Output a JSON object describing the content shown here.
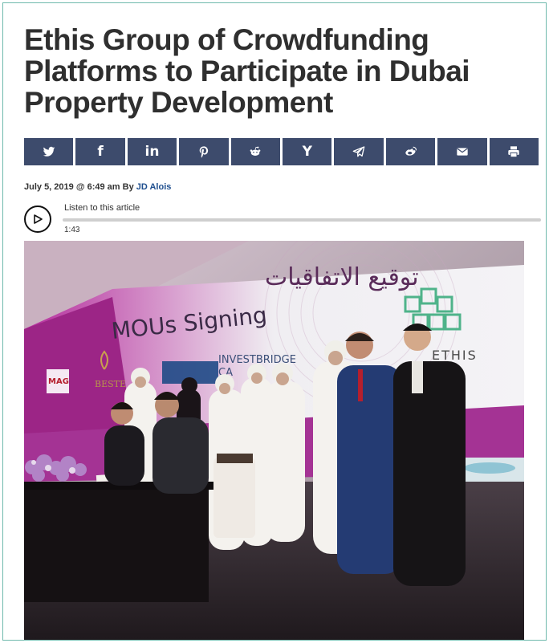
{
  "article": {
    "title": "Ethis Group of Crowdfunding Platforms to Participate in Dubai Property Development",
    "date": "July 5, 2019 @ 6:49 am By",
    "author": "JD Alois"
  },
  "share_bar": {
    "color": "#3d4b6c",
    "buttons": [
      {
        "name": "twitter",
        "glyph": ""
      },
      {
        "name": "facebook",
        "glyph": "f"
      },
      {
        "name": "linkedin",
        "glyph": "in"
      },
      {
        "name": "pinterest",
        "glyph": ""
      },
      {
        "name": "reddit",
        "glyph": ""
      },
      {
        "name": "hacker-news",
        "glyph": "Y"
      },
      {
        "name": "telegram",
        "glyph": ""
      },
      {
        "name": "weibo",
        "glyph": ""
      },
      {
        "name": "email",
        "glyph": ""
      },
      {
        "name": "print",
        "glyph": ""
      }
    ]
  },
  "audio_player": {
    "label": "Listen to this article",
    "duration": "1:43",
    "progress": 0
  },
  "photo": {
    "banner_arabic": "توقيع الاتفاقيات",
    "banner_english": "MOUs Signing",
    "sponsor_1": "MAG",
    "sponsor_2": "BESTE",
    "sponsor_3": "INVESTBRIDGE",
    "sponsor_3b": "CA",
    "sponsor_4": "ETHIS"
  }
}
